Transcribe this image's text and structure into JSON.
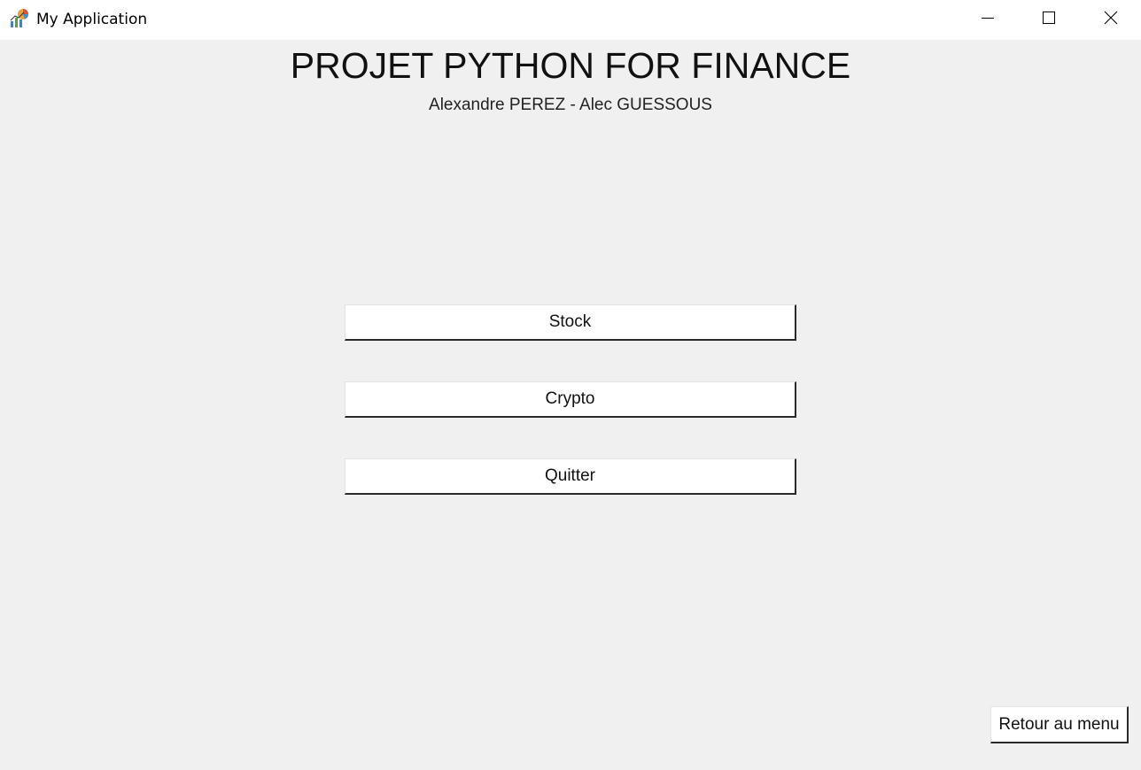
{
  "window": {
    "title": "My Application",
    "app_icon": "chart-app-icon",
    "controls": {
      "minimize_icon": "minimize-icon",
      "maximize_icon": "maximize-icon",
      "close_icon": "close-icon"
    }
  },
  "header": {
    "title": "PROJET PYTHON FOR FINANCE",
    "authors": "Alexandre PEREZ - Alec GUESSOUS"
  },
  "menu": {
    "buttons": [
      {
        "label": "Stock"
      },
      {
        "label": "Crypto"
      },
      {
        "label": "Quitter"
      }
    ]
  },
  "footer": {
    "back_label": "Retour au menu"
  },
  "colors": {
    "background": "#f0f0f0",
    "titlebar": "#ffffff",
    "button": "#ffffff",
    "text": "#111111"
  }
}
